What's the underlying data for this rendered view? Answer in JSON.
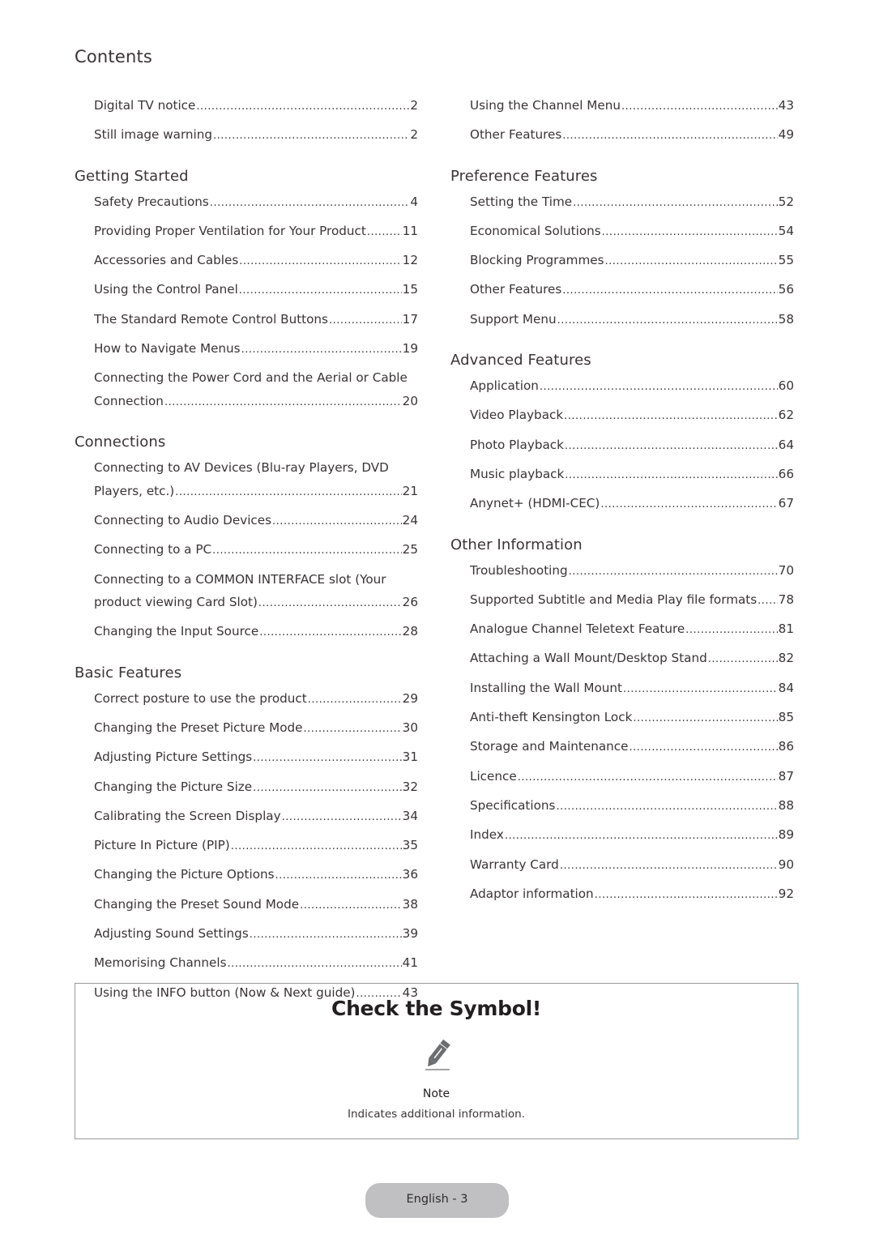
{
  "title": "Contents",
  "left_column": [
    {
      "heading": "",
      "entries": [
        {
          "label": "Digital TV notice",
          "page": "2"
        },
        {
          "label": "Still image warning",
          "page": "2"
        }
      ]
    },
    {
      "heading": "Getting Started",
      "entries": [
        {
          "label": "Safety Precautions",
          "page": "4"
        },
        {
          "label": "Providing Proper Ventilation for Your Product",
          "page": "11"
        },
        {
          "label": "Accessories and Cables",
          "page": "12"
        },
        {
          "label": "Using the Control Panel",
          "page": "15"
        },
        {
          "label": "The Standard Remote Control Buttons",
          "page": "17"
        },
        {
          "label": "How to Navigate Menus",
          "page": "19"
        },
        {
          "label_line1": "Connecting the Power Cord and the Aerial or Cable",
          "label": "Connection",
          "page": "20"
        }
      ]
    },
    {
      "heading": "Connections",
      "entries": [
        {
          "label_line1": "Connecting to AV Devices (Blu-ray Players, DVD",
          "label": "Players, etc.)",
          "page": "21"
        },
        {
          "label": "Connecting to Audio Devices",
          "page": "24"
        },
        {
          "label": "Connecting to a PC",
          "page": "25"
        },
        {
          "label_line1": "Connecting to a COMMON INTERFACE slot (Your",
          "label": "product viewing Card Slot)",
          "page": "26"
        },
        {
          "label": "Changing the Input Source",
          "page": "28"
        }
      ]
    },
    {
      "heading": "Basic Features",
      "entries": [
        {
          "label": "Correct posture to use the product",
          "page": "29"
        },
        {
          "label": "Changing the Preset Picture Mode",
          "page": "30"
        },
        {
          "label": "Adjusting Picture Settings",
          "page": "31"
        },
        {
          "label": "Changing the Picture Size",
          "page": "32"
        },
        {
          "label": "Calibrating the Screen Display",
          "page": "34"
        },
        {
          "label": "Picture In Picture (PIP)",
          "page": "35"
        },
        {
          "label": "Changing the Picture Options",
          "page": "36"
        },
        {
          "label": "Changing the Preset Sound Mode",
          "page": "38"
        },
        {
          "label": "Adjusting Sound Settings",
          "page": "39"
        },
        {
          "label": "Memorising Channels",
          "page": "41"
        },
        {
          "label": "Using the INFO button (Now & Next guide)",
          "page": "43"
        }
      ]
    }
  ],
  "right_column": [
    {
      "heading": "",
      "entries": [
        {
          "label": "Using the Channel Menu",
          "page": "43"
        },
        {
          "label": "Other Features",
          "page": "49"
        }
      ]
    },
    {
      "heading": "Preference Features",
      "entries": [
        {
          "label": "Setting the Time",
          "page": "52"
        },
        {
          "label": "Economical Solutions",
          "page": "54"
        },
        {
          "label": "Blocking Programmes",
          "page": "55"
        },
        {
          "label": "Other Features",
          "page": "56"
        },
        {
          "label": "Support Menu",
          "page": "58"
        }
      ]
    },
    {
      "heading": "Advanced Features",
      "entries": [
        {
          "label": "Application",
          "page": "60"
        },
        {
          "label": "Video Playback",
          "page": "62"
        },
        {
          "label": "Photo Playback",
          "page": "64"
        },
        {
          "label": "Music playback",
          "page": "66"
        },
        {
          "label": "Anynet+ (HDMI-CEC)",
          "page": "67"
        }
      ]
    },
    {
      "heading": "Other Information",
      "entries": [
        {
          "label": "Troubleshooting",
          "page": "70"
        },
        {
          "label": "Supported Subtitle and Media Play file formats",
          "page": "78"
        },
        {
          "label": "Analogue Channel Teletext Feature",
          "page": "81"
        },
        {
          "label": "Attaching a Wall Mount/Desktop Stand",
          "page": "82"
        },
        {
          "label": "Installing the Wall Mount",
          "page": "84"
        },
        {
          "label": "Anti-theft Kensington Lock",
          "page": "85"
        },
        {
          "label": "Storage and Maintenance",
          "page": "86"
        },
        {
          "label": "Licence",
          "page": "87"
        },
        {
          "label": "Specifications",
          "page": "88"
        },
        {
          "label": "Index",
          "page": "89"
        },
        {
          "label": "Warranty Card",
          "page": "90"
        },
        {
          "label": "Adaptor information",
          "page": "92"
        }
      ]
    }
  ],
  "symbol_box": {
    "title": "Check the Symbol!",
    "icon": "pencil-note-icon",
    "icon_color": "#6d6e71",
    "note_label": "Note",
    "note_description": "Indicates additional information."
  },
  "footer": {
    "page_label": "English - 3",
    "pill_color": "#c0c0c2"
  }
}
